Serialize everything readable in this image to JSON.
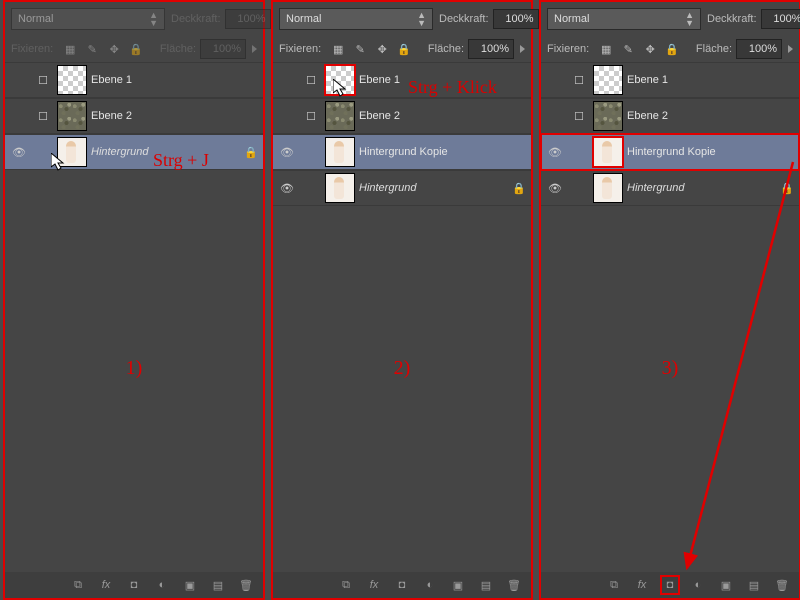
{
  "common": {
    "blend_mode": "Normal",
    "opacity_label": "Deckkraft:",
    "opacity_value": "100%",
    "lock_label": "Fixieren:",
    "fill_label": "Fläche:",
    "fill_value": "100%"
  },
  "panels": [
    {
      "step_label": "1)",
      "annotation": "Strg + J",
      "dimmed_controls": true,
      "layers": [
        {
          "name": "Ebene 1",
          "thumb": "trans",
          "visible": false,
          "checkbox": true,
          "selected": false,
          "locked": false,
          "italic": false,
          "highlight": false
        },
        {
          "name": "Ebene 2",
          "thumb": "noise",
          "visible": false,
          "checkbox": true,
          "selected": false,
          "locked": false,
          "italic": false,
          "highlight": false
        },
        {
          "name": "Hintergrund",
          "thumb": "photo",
          "visible": true,
          "checkbox": false,
          "selected": true,
          "locked": true,
          "italic": true,
          "highlight": false,
          "cursor": true
        }
      ]
    },
    {
      "step_label": "2)",
      "annotation": "Strg + Klick",
      "dimmed_controls": false,
      "layers": [
        {
          "name": "Ebene 1",
          "thumb": "trans",
          "visible": false,
          "checkbox": true,
          "selected": false,
          "locked": false,
          "italic": false,
          "highlight": true,
          "cursor": true
        },
        {
          "name": "Ebene 2",
          "thumb": "noise",
          "visible": false,
          "checkbox": true,
          "selected": false,
          "locked": false,
          "italic": false,
          "highlight": false
        },
        {
          "name": "Hintergrund Kopie",
          "thumb": "photo",
          "visible": true,
          "checkbox": false,
          "selected": true,
          "locked": false,
          "italic": false,
          "highlight": false
        },
        {
          "name": "Hintergrund",
          "thumb": "photo",
          "visible": true,
          "checkbox": false,
          "selected": false,
          "locked": true,
          "italic": true,
          "highlight": false
        }
      ]
    },
    {
      "step_label": "3)",
      "annotation": "",
      "dimmed_controls": false,
      "arrow_to_mask": true,
      "layers": [
        {
          "name": "Ebene 1",
          "thumb": "trans",
          "visible": false,
          "checkbox": true,
          "selected": false,
          "locked": false,
          "italic": false,
          "highlight": false
        },
        {
          "name": "Ebene 2",
          "thumb": "noise",
          "visible": false,
          "checkbox": true,
          "selected": false,
          "locked": false,
          "italic": false,
          "highlight": false
        },
        {
          "name": "Hintergrund Kopie",
          "thumb": "photo",
          "visible": true,
          "checkbox": false,
          "selected": true,
          "locked": false,
          "italic": false,
          "highlight": false,
          "row_highlight": true
        },
        {
          "name": "Hintergrund",
          "thumb": "photo",
          "visible": true,
          "checkbox": false,
          "selected": false,
          "locked": true,
          "italic": true,
          "highlight": false
        }
      ]
    }
  ],
  "bottom_icons": [
    "link-icon",
    "fx-icon",
    "mask-icon",
    "adjust-icon",
    "group-icon",
    "new-icon",
    "trash-icon"
  ]
}
